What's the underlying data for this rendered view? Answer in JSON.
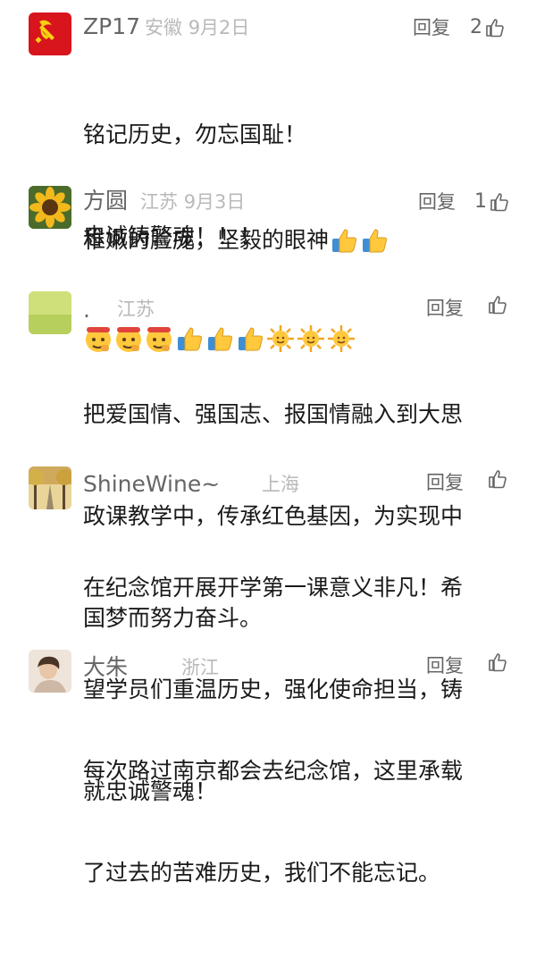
{
  "ui": {
    "reply_label": "回复",
    "thumb_icon": "thumbs-up-outline"
  },
  "comments": [
    {
      "name": "ZP17",
      "location": "安徽",
      "date": "9月2日",
      "likes": "2",
      "lines": [
        "铭记历史，勿忘国耻！",
        "忠诚铸警魂！！！"
      ],
      "emojis": [
        "salute-face",
        "salute-face",
        "salute-face",
        "thumbs-up",
        "thumbs-up",
        "thumbs-up",
        "sun",
        "sun",
        "sun"
      ],
      "avatar": "party-flag"
    },
    {
      "name": "方圆",
      "location": "江苏",
      "date": "9月3日",
      "likes": "1",
      "lines": [
        "稚嫩的脸庞，坚毅的眼神"
      ],
      "inline_emojis": [
        "thumbs-up",
        "thumbs-up"
      ],
      "avatar": "sunflower"
    },
    {
      "name": ".",
      "location": "江苏",
      "date": "",
      "likes": "",
      "lines": [
        "把爱国情、强国志、报国情融入到大思",
        "政课教学中，传承红色基因，为实现中",
        "国梦而努力奋斗。"
      ],
      "avatar": "green-field"
    },
    {
      "name": "ShineWine~",
      "location": "上海",
      "date": "",
      "likes": "",
      "lines": [
        "在纪念馆开展开学第一课意义非凡！希",
        "望学员们重温历史，强化使命担当，铸",
        "就忠诚警魂！"
      ],
      "avatar": "tree-road"
    },
    {
      "name": "大朱",
      "location": "浙江",
      "date": "",
      "likes": "",
      "lines": [
        "每次路过南京都会去纪念馆，这里承载",
        "了过去的苦难历史，我们不能忘记。"
      ],
      "avatar": "person-photo"
    }
  ]
}
